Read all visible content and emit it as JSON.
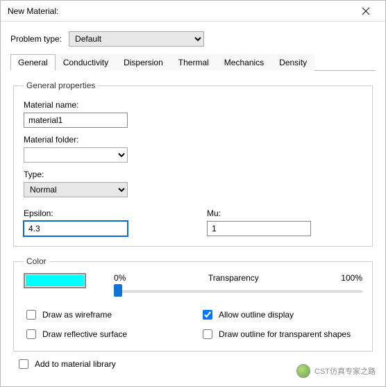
{
  "window": {
    "title": "New Material:"
  },
  "problemType": {
    "label": "Problem type:",
    "value": "Default"
  },
  "tabs": [
    "General",
    "Conductivity",
    "Dispersion",
    "Thermal",
    "Mechanics",
    "Density"
  ],
  "activeTab": "General",
  "general": {
    "legend": "General properties",
    "materialNameLabel": "Material name:",
    "materialName": "material1",
    "materialFolderLabel": "Material folder:",
    "materialFolder": "",
    "typeLabel": "Type:",
    "typeValue": "Normal",
    "epsilonLabel": "Epsilon:",
    "epsilon": "4.3",
    "muLabel": "Mu:",
    "mu": "1"
  },
  "color": {
    "legend": "Color",
    "swatch": "#00ffff",
    "transLeft": "0%",
    "transMid": "Transparency",
    "transRight": "100%",
    "transValue": 0,
    "drawWireframe": "Draw as wireframe",
    "drawReflective": "Draw reflective surface",
    "allowOutline": "Allow outline display",
    "drawOutlineTransparent": "Draw outline for transparent shapes",
    "checks": {
      "wireframe": false,
      "reflective": false,
      "allowOutline": true,
      "outlineTransparent": false
    }
  },
  "addToLib": "Add to material library",
  "watermark": "CST仿真专家之路"
}
